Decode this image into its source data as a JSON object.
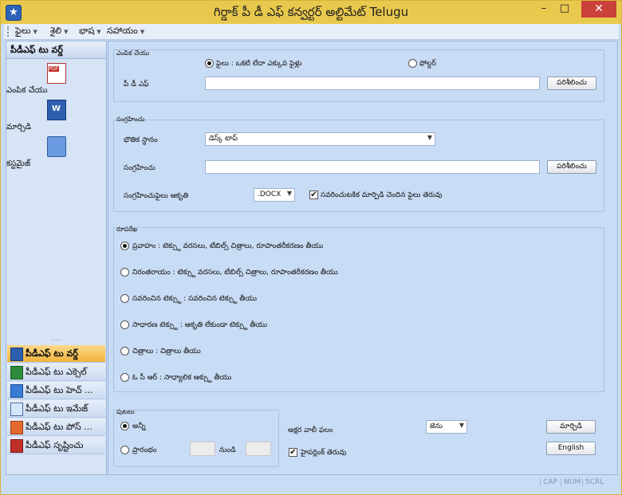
{
  "window": {
    "title": "గిర్డాక్ పీ డీ ఎఫ్ కన్వర్టర్ అల్టిమేట్ Telugu",
    "min_icon": "minimize-icon",
    "max_icon": "maximize-icon",
    "close_icon": "close-icon",
    "min_glyph": "–",
    "max_glyph": "□",
    "close_glyph": "✕"
  },
  "menu": [
    "ఫైలు",
    "శైలి",
    "భాష",
    "సహాయం"
  ],
  "sidebar": {
    "header": "పీడీఎఫ్ టు వర్డ్",
    "tools": [
      "ఎంపిక చేయు",
      "మార్చిడి",
      "కస్టమైజ్"
    ],
    "nav": [
      {
        "label": "పీడీఎఫ్ టు వర్డ్",
        "icon": "word-icon",
        "active": true
      },
      {
        "label": "పీడీఎఫ్ టు ఎక్సెల్",
        "icon": "excel-icon"
      },
      {
        "label": "పీడీఎఫ్ టు హెచ్ ...",
        "icon": "html-icon"
      },
      {
        "label": "పీడీఎఫ్ టు ఇమేజ్",
        "icon": "image-icon"
      },
      {
        "label": "పీడీఎఫ్ టు పోస్ ...",
        "icon": "postscript-icon"
      },
      {
        "label": "పీడీఎఫ్ సృష్టించు",
        "icon": "pdf-create-icon"
      }
    ]
  },
  "select_group": {
    "title": "ఎంపిక చేయు",
    "radio_file": "ఫైలు : ఒకటి లేదా ఎక్కువ ఫైళ్లు",
    "radio_folder": "ఫోల్డర్",
    "pdf_label": "పీ డీ ఎఫ్",
    "pdf_value": "",
    "browse": "పరిశీలించు"
  },
  "save_group": {
    "title": "సంగ్రహించు",
    "location_label": "భౌతిక స్థానం",
    "location_value": "డెస్క్ టాప్",
    "save_label": "సంగ్రహించు",
    "save_value": "",
    "browse": "పరిశీలించు",
    "format_label": "సంగ్రహించుఫైలు ఆకృతి",
    "format_value": ".DOCX",
    "open_after": "సవరించుటకిక మార్పిడి చెందిన ఫైలు తెరువు"
  },
  "layout_group": {
    "title": "రూపరేఖ",
    "options": [
      "ప్రవాహం : టెక్స్టు వరసలు, టేబిల్స్ చిత్రాలు, రూపాంతరీకరణం తీయు",
      "నిరంతరాయం : టెక్స్టు వరసలు, టేబిల్స్ చిత్రాలు, రూపాంతరీకరణం తీయు",
      "సవరించిన టెక్స్టు : సవరించిన టెక్స్టు తీయు",
      "సాధారణ టెక్స్టు : ఆకృతి లేకుండా టెక్స్టు తీయు",
      "చిత్రాలు : చిత్రాలు తీయు",
      "ఓ సీ ఆర్ : సాధ్యాలిక ఆక్స్టు తీయు"
    ]
  },
  "pages_group": {
    "title": "పుటలు",
    "all": "అన్నీ",
    "range": "ప్రారంభం",
    "from_value": "",
    "to_label": "నుండి",
    "to_value": ""
  },
  "language_label": "అక్షర వాలీ ఫలం",
  "language_value": "జెను",
  "hyperlink": "హైపర్లింక్ తెరువు",
  "convert_button": "మార్చిడి",
  "english_button": "English",
  "status": [
    "CAP",
    "NUM",
    "SCRL"
  ]
}
